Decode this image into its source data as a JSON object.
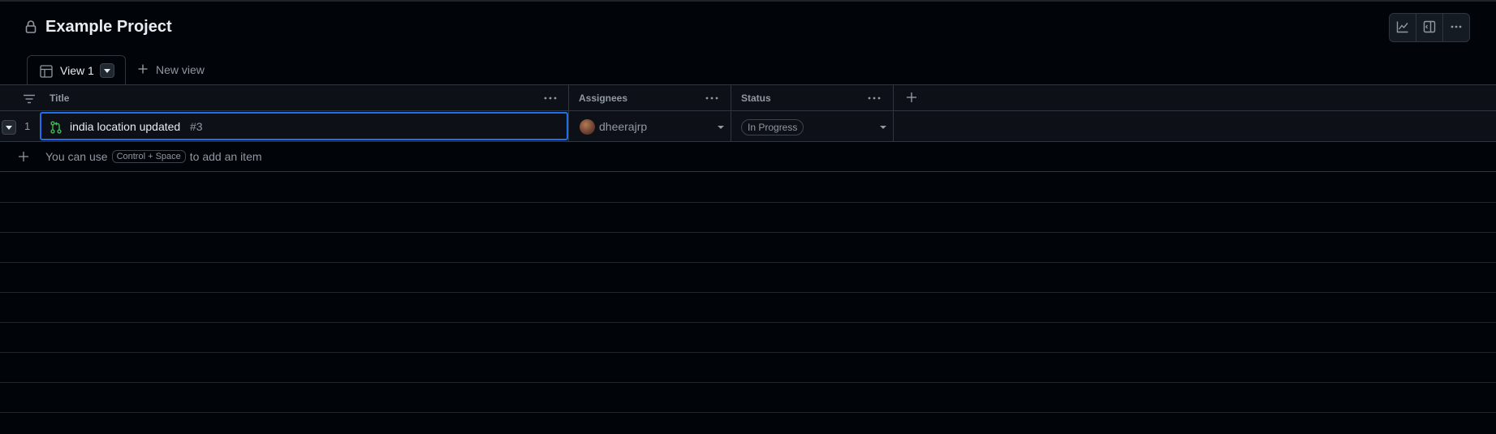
{
  "project": {
    "title": "Example Project"
  },
  "toolbar": {
    "insights_icon": "graph-icon",
    "panel_icon": "sidebar-expand-icon",
    "more_icon": "kebab-horizontal-icon"
  },
  "tabs": {
    "active": {
      "label": "View 1",
      "icon": "table-icon"
    },
    "new_view_label": "New view"
  },
  "columns": [
    {
      "label": "Title"
    },
    {
      "label": "Assignees"
    },
    {
      "label": "Status"
    }
  ],
  "rows": [
    {
      "index": "1",
      "title": "india location updated",
      "number": "#3",
      "type_icon": "git-pull-request-icon",
      "assignee": "dheerajrp",
      "status": "In Progress"
    }
  ],
  "add_item_hint": {
    "prefix": "You can use",
    "key1": "Control",
    "plus": "+",
    "key2": "Space",
    "suffix": "to add an item"
  },
  "colors": {
    "background": "#010409",
    "accent_focus": "#1f6feb",
    "pr_open": "#3fb950",
    "text": "#e6edf3",
    "muted": "#9198a1"
  }
}
